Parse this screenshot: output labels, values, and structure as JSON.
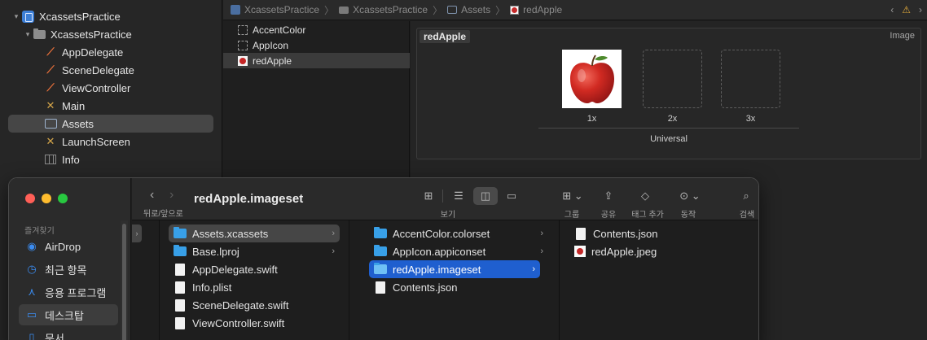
{
  "navigator": {
    "items": [
      {
        "label": "XcassetsPractice",
        "icon": "xcode-project-icon"
      },
      {
        "label": "XcassetsPractice",
        "icon": "folder-icon"
      },
      {
        "label": "AppDelegate",
        "icon": "swift-file-icon"
      },
      {
        "label": "SceneDelegate",
        "icon": "swift-file-icon"
      },
      {
        "label": "ViewController",
        "icon": "swift-file-icon"
      },
      {
        "label": "Main",
        "icon": "storyboard-icon"
      },
      {
        "label": "Assets",
        "icon": "asset-catalog-icon"
      },
      {
        "label": "LaunchScreen",
        "icon": "storyboard-icon"
      },
      {
        "label": "Info",
        "icon": "plist-icon"
      }
    ]
  },
  "pathbar": {
    "segments": [
      "XcassetsPractice",
      "XcassetsPractice",
      "Assets",
      "redApple"
    ]
  },
  "asset_list": {
    "items": [
      "AccentColor",
      "AppIcon",
      "redApple"
    ]
  },
  "imageset": {
    "name": "redApple",
    "type": "Image",
    "slots": [
      "1x",
      "2x",
      "3x"
    ],
    "group": "Universal"
  },
  "finder": {
    "title": "redApple.imageset",
    "back_label": "뒤로/앞으로",
    "view_label": "보기",
    "group_label": "그룹",
    "share_label": "공유",
    "tag_label": "태그 추가",
    "action_label": "동작",
    "search_label": "검색",
    "sidebar": {
      "section": "즐겨찾기",
      "items": [
        {
          "label": "AirDrop",
          "icon": "airdrop-icon"
        },
        {
          "label": "최근 항목",
          "icon": "clock-icon"
        },
        {
          "label": "응용 프로그램",
          "icon": "applications-icon"
        },
        {
          "label": "데스크탑",
          "icon": "desktop-icon"
        },
        {
          "label": "문서",
          "icon": "document-icon"
        }
      ]
    },
    "col1": [
      "Assets.xcassets",
      "Base.lproj",
      "AppDelegate.swift",
      "Info.plist",
      "SceneDelegate.swift",
      "ViewController.swift"
    ],
    "col2": [
      "AccentColor.colorset",
      "AppIcon.appiconset",
      "redApple.imageset",
      "Contents.json"
    ],
    "col3": [
      "Contents.json",
      "redApple.jpeg"
    ]
  },
  "colors": {
    "accent": "#1f5fcf",
    "folder": "#38a0e8"
  }
}
